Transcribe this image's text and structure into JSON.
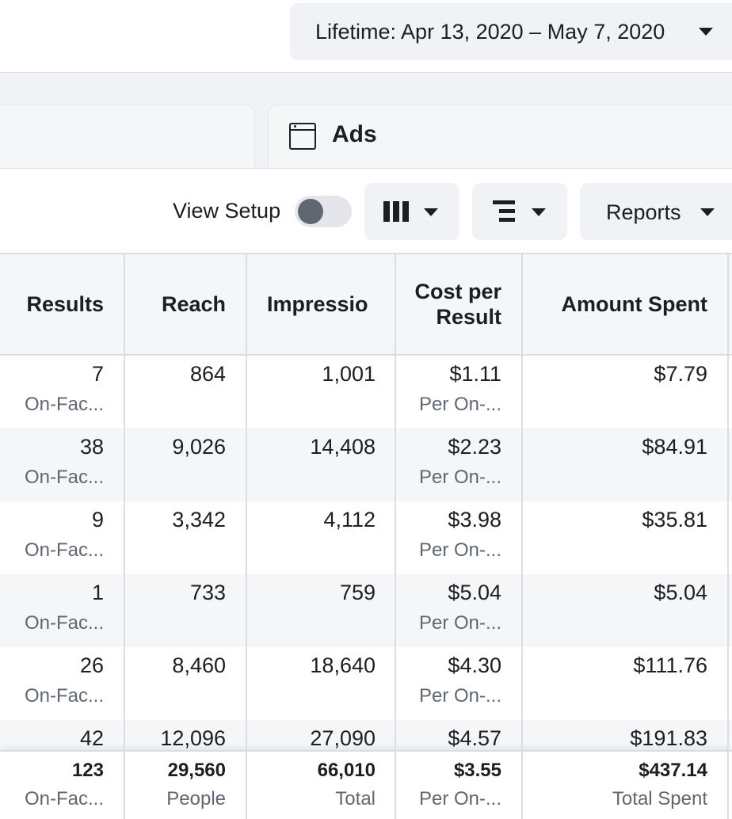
{
  "date_range": {
    "label": "Lifetime: Apr 13, 2020 – May 7, 2020"
  },
  "tabs": {
    "ads_label": "Ads"
  },
  "toolbar": {
    "view_setup_label": "View Setup",
    "view_setup_on": false,
    "reports_label": "Reports"
  },
  "table": {
    "headers": {
      "results": "Results",
      "reach": "Reach",
      "impressions": "Impressio",
      "cost_per_result": "Cost per Result",
      "amount_spent": "Amount Spent"
    },
    "rows": [
      {
        "results": "7",
        "results_sub": "On-Fac...",
        "reach": "864",
        "impressions": "1,001",
        "cost": "$1.11",
        "cost_sub": "Per On-...",
        "spent": "$7.79"
      },
      {
        "results": "38",
        "results_sub": "On-Fac...",
        "reach": "9,026",
        "impressions": "14,408",
        "cost": "$2.23",
        "cost_sub": "Per On-...",
        "spent": "$84.91"
      },
      {
        "results": "9",
        "results_sub": "On-Fac...",
        "reach": "3,342",
        "impressions": "4,112",
        "cost": "$3.98",
        "cost_sub": "Per On-...",
        "spent": "$35.81"
      },
      {
        "results": "1",
        "results_sub": "On-Fac...",
        "reach": "733",
        "impressions": "759",
        "cost": "$5.04",
        "cost_sub": "Per On-...",
        "spent": "$5.04"
      },
      {
        "results": "26",
        "results_sub": "On-Fac...",
        "reach": "8,460",
        "impressions": "18,640",
        "cost": "$4.30",
        "cost_sub": "Per On-...",
        "spent": "$111.76"
      },
      {
        "results": "42",
        "results_sub": "",
        "reach": "12,096",
        "impressions": "27,090",
        "cost": "$4.57",
        "cost_sub": "",
        "spent": "$191.83"
      }
    ],
    "totals": {
      "results": "123",
      "results_sub": "On-Fac...",
      "reach": "29,560",
      "reach_sub": "People",
      "impressions": "66,010",
      "impressions_sub": "Total",
      "cost": "$3.55",
      "cost_sub": "Per On-...",
      "spent": "$437.14",
      "spent_sub": "Total Spent"
    }
  }
}
